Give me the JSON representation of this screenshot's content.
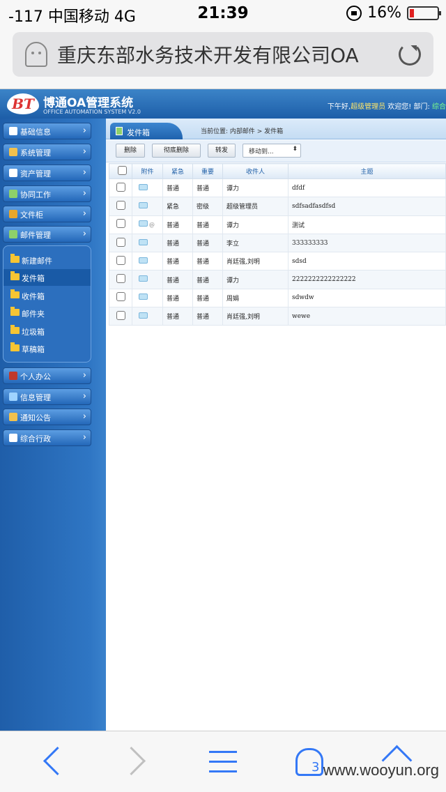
{
  "status_bar": {
    "carrier": "-117 中国移动   4G",
    "time": "21:39",
    "battery": "16%",
    "battery_level": 0.16
  },
  "browser": {
    "url_title": "重庆东部水务技术开发有限公司OA",
    "tab_count": "3"
  },
  "app": {
    "logo": "BT",
    "title": "博通OA管理系统",
    "subtitle": "OFFICE AUTOMATION SYSTEM V2.0",
    "greeting_prefix": "下午好,",
    "user_name": "超级管理员",
    "greeting_suffix": " 欢迎您!  部门: ",
    "dept": "综合"
  },
  "sidebar": {
    "items_top": [
      {
        "label": "基础信息",
        "icon": "edit-icon",
        "color": "#ffffff"
      },
      {
        "label": "系统管理",
        "icon": "user-icon",
        "color": "#f2c14e"
      },
      {
        "label": "资产管理",
        "icon": "book-icon",
        "color": "#ffffff"
      },
      {
        "label": "协同工作",
        "icon": "workflow-icon",
        "color": "#8ed06a"
      },
      {
        "label": "文件柜",
        "icon": "cabinet-icon",
        "color": "#e8a72a"
      },
      {
        "label": "邮件管理",
        "icon": "mail-arrow-icon",
        "color": "#8ed06a"
      }
    ],
    "submenu": [
      {
        "label": "新建邮件"
      },
      {
        "label": "发件箱",
        "active": true
      },
      {
        "label": "收件箱"
      },
      {
        "label": "邮件夹"
      },
      {
        "label": "垃圾箱"
      },
      {
        "label": "草稿箱"
      }
    ],
    "items_bottom": [
      {
        "label": "个人办公",
        "icon": "notebook-icon",
        "color": "#c0392b"
      },
      {
        "label": "信息管理",
        "icon": "info-icon",
        "color": "#9fd3ff"
      },
      {
        "label": "通知公告",
        "icon": "notice-icon",
        "color": "#f2c14e"
      },
      {
        "label": "综合行政",
        "icon": "admin-icon",
        "color": "#ffffff"
      }
    ]
  },
  "main": {
    "tab_label": "发件箱",
    "breadcrumb": "当前位置: 内部邮件 > 发件箱",
    "toolbar": {
      "delete": "删除",
      "delete_all": "彻底删除",
      "forward": "转发",
      "move_to": "移动到..."
    },
    "columns": [
      "",
      "附件",
      "紧急",
      "重要",
      "收件人",
      "主题"
    ],
    "rows": [
      {
        "attach": false,
        "urgent": "普通",
        "important": "普通",
        "to": "谭力",
        "subject": "dfdf"
      },
      {
        "attach": false,
        "urgent": "紧急",
        "important": "密级",
        "to": "超级管理员",
        "subject": "sdfsadfasdfsd"
      },
      {
        "attach": true,
        "urgent": "普通",
        "important": "普通",
        "to": "谭力",
        "subject": "测试"
      },
      {
        "attach": false,
        "urgent": "普通",
        "important": "普通",
        "to": "李立",
        "subject": "333333333"
      },
      {
        "attach": false,
        "urgent": "普通",
        "important": "普通",
        "to": "肖廷强,刘明",
        "subject": "sdsd"
      },
      {
        "attach": false,
        "urgent": "普通",
        "important": "普通",
        "to": "谭力",
        "subject": "2222222222222222"
      },
      {
        "attach": false,
        "urgent": "普通",
        "important": "普通",
        "to": "周娟",
        "subject": "sdwdw"
      },
      {
        "attach": false,
        "urgent": "普通",
        "important": "普通",
        "to": "肖廷强,刘明",
        "subject": "wewe"
      }
    ]
  },
  "watermark": "www.wooyun.org"
}
